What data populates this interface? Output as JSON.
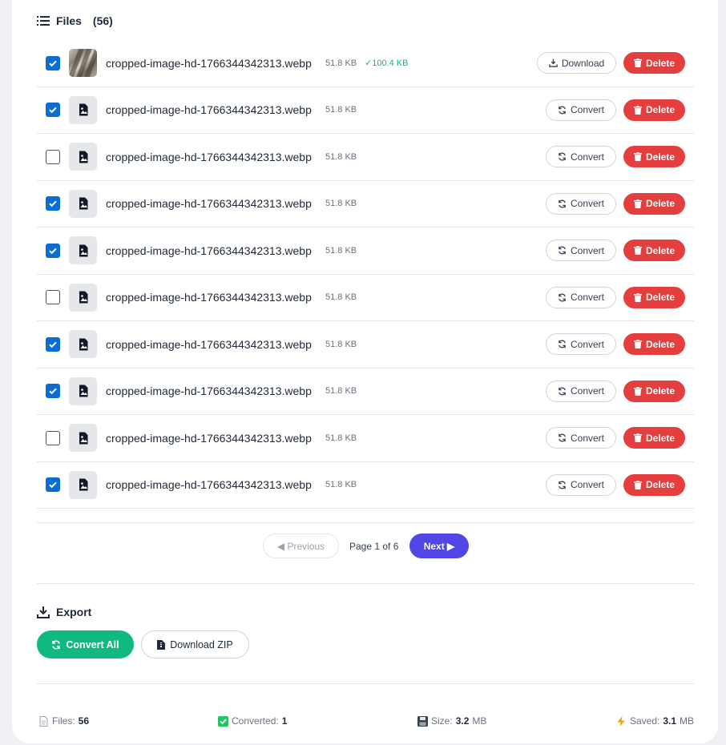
{
  "files": {
    "title": "Files",
    "count": "(56)",
    "rows": [
      {
        "name": "cropped-image-hd-1766344342313.webp",
        "size": "51.8 KB",
        "saved": "✓100.4 KB",
        "checked": true,
        "thumb": "photo",
        "action": "Download",
        "delete": "Delete"
      },
      {
        "name": "cropped-image-hd-1766344342313.webp",
        "size": "51.8 KB",
        "saved": "",
        "checked": true,
        "thumb": "file-image-icon",
        "action": "Convert",
        "delete": "Delete"
      },
      {
        "name": "cropped-image-hd-1766344342313.webp",
        "size": "51.8 KB",
        "saved": "",
        "checked": false,
        "thumb": "file-image-icon",
        "action": "Convert",
        "delete": "Delete"
      },
      {
        "name": "cropped-image-hd-1766344342313.webp",
        "size": "51.8 KB",
        "saved": "",
        "checked": true,
        "thumb": "file-image-icon",
        "action": "Convert",
        "delete": "Delete"
      },
      {
        "name": "cropped-image-hd-1766344342313.webp",
        "size": "51.8 KB",
        "saved": "",
        "checked": true,
        "thumb": "file-image-icon",
        "action": "Convert",
        "delete": "Delete"
      },
      {
        "name": "cropped-image-hd-1766344342313.webp",
        "size": "51.8 KB",
        "saved": "",
        "checked": false,
        "thumb": "file-image-icon",
        "action": "Convert",
        "delete": "Delete"
      },
      {
        "name": "cropped-image-hd-1766344342313.webp",
        "size": "51.8 KB",
        "saved": "",
        "checked": true,
        "thumb": "file-image-icon",
        "action": "Convert",
        "delete": "Delete"
      },
      {
        "name": "cropped-image-hd-1766344342313.webp",
        "size": "51.8 KB",
        "saved": "",
        "checked": true,
        "thumb": "file-image-icon",
        "action": "Convert",
        "delete": "Delete"
      },
      {
        "name": "cropped-image-hd-1766344342313.webp",
        "size": "51.8 KB",
        "saved": "",
        "checked": false,
        "thumb": "file-image-icon",
        "action": "Convert",
        "delete": "Delete"
      },
      {
        "name": "cropped-image-hd-1766344342313.webp",
        "size": "51.8 KB",
        "saved": "",
        "checked": true,
        "thumb": "file-image-icon",
        "action": "Convert",
        "delete": "Delete"
      }
    ]
  },
  "pagination": {
    "prev_label": "◀ Previous",
    "page_info": "Page 1 of 6",
    "next_label": "Next ▶"
  },
  "export": {
    "title": "Export",
    "convert_all_label": "Convert All",
    "download_zip_label": "Download ZIP"
  },
  "stats": {
    "files_label": "Files:",
    "files_value": "56",
    "converted_label": "Converted:",
    "converted_value": "1",
    "size_label": "Size:",
    "size_value": "3.2",
    "size_unit": "MB",
    "saved_label": "Saved:",
    "saved_value": "3.1",
    "saved_unit": "MB"
  },
  "colors": {
    "checkbox": "#0b6cd6",
    "delete": "#e53e3e",
    "next": "#4f46e5",
    "convert_all": "#10b981",
    "saved_text": "#10b981"
  }
}
